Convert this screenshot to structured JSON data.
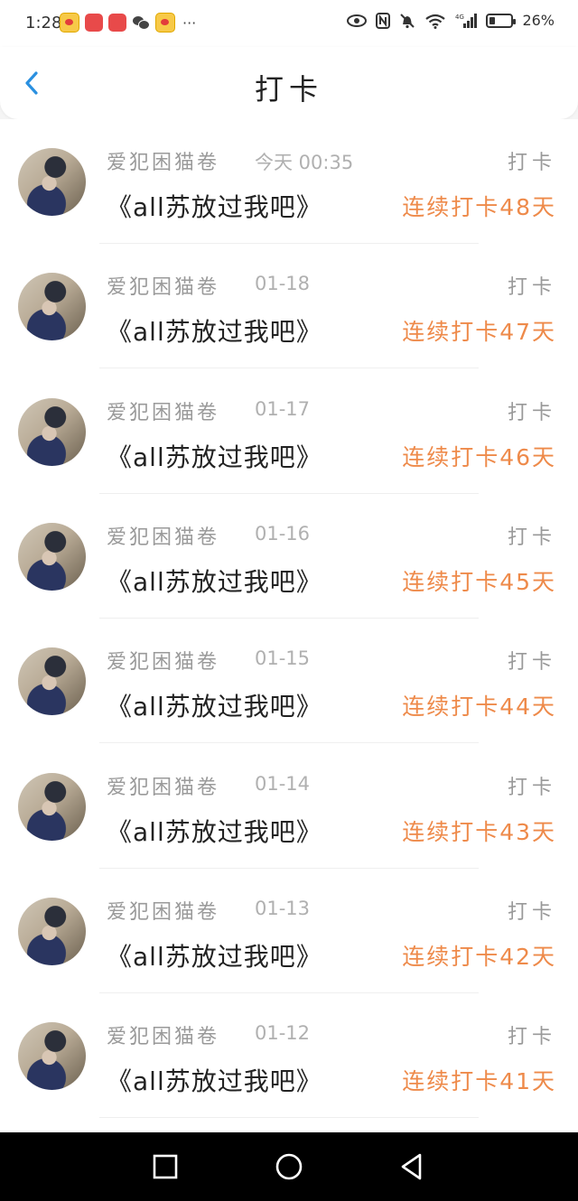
{
  "status_bar": {
    "time": "1:28",
    "more": "···",
    "battery_percent": "26%",
    "battery_level": 0.26,
    "icons": [
      "weibo-icon",
      "huawei-app-icon",
      "huawei-app-icon",
      "wechat-icon",
      "weibo-icon",
      "eye-icon",
      "nfc-icon",
      "mute-icon",
      "wifi-icon",
      "signal-icon",
      "battery-icon"
    ]
  },
  "header": {
    "title": "打卡"
  },
  "records": [
    {
      "name": "爱犯困猫卷",
      "date": "今天 00:35",
      "tag": "打卡",
      "book": "《all苏放过我吧》",
      "streak": "连续打卡48天"
    },
    {
      "name": "爱犯困猫卷",
      "date": "01-18",
      "tag": "打卡",
      "book": "《all苏放过我吧》",
      "streak": "连续打卡47天"
    },
    {
      "name": "爱犯困猫卷",
      "date": "01-17",
      "tag": "打卡",
      "book": "《all苏放过我吧》",
      "streak": "连续打卡46天"
    },
    {
      "name": "爱犯困猫卷",
      "date": "01-16",
      "tag": "打卡",
      "book": "《all苏放过我吧》",
      "streak": "连续打卡45天"
    },
    {
      "name": "爱犯困猫卷",
      "date": "01-15",
      "tag": "打卡",
      "book": "《all苏放过我吧》",
      "streak": "连续打卡44天"
    },
    {
      "name": "爱犯困猫卷",
      "date": "01-14",
      "tag": "打卡",
      "book": "《all苏放过我吧》",
      "streak": "连续打卡43天"
    },
    {
      "name": "爱犯困猫卷",
      "date": "01-13",
      "tag": "打卡",
      "book": "《all苏放过我吧》",
      "streak": "连续打卡42天"
    },
    {
      "name": "爱犯困猫卷",
      "date": "01-12",
      "tag": "打卡",
      "book": "《all苏放过我吧》",
      "streak": "连续打卡41天"
    }
  ],
  "colors": {
    "accent": "#2a90e0",
    "streak": "#ee8a4a"
  }
}
